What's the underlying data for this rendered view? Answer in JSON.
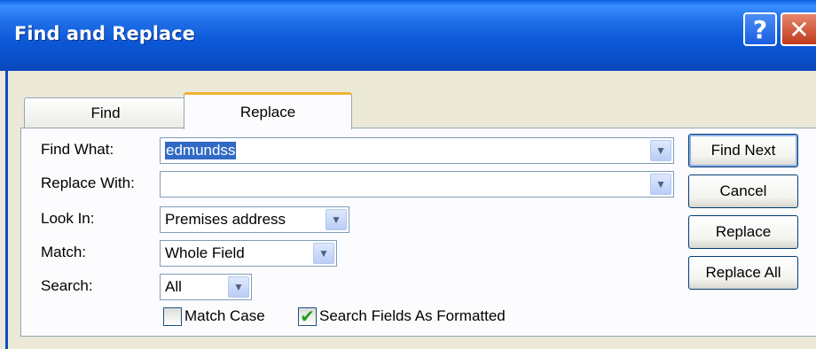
{
  "window": {
    "title": "Find and Replace",
    "help_glyph": "?",
    "close_glyph": "✕"
  },
  "tabs": [
    {
      "label": "Find",
      "active": false
    },
    {
      "label": "Replace",
      "active": true
    }
  ],
  "fields": {
    "find_what": {
      "label": "Find What:",
      "value": "edmundss"
    },
    "replace_with": {
      "label": "Replace With:",
      "value": ""
    },
    "look_in": {
      "label": "Look In:",
      "value": "Premises address"
    },
    "match": {
      "label": "Match:",
      "value": "Whole Field"
    },
    "search": {
      "label": "Search:",
      "value": "All"
    }
  },
  "checkboxes": {
    "match_case": {
      "label": "Match Case",
      "checked": false
    },
    "search_formatted": {
      "label": "Search Fields As Formatted",
      "checked": true
    }
  },
  "buttons": {
    "find_next": "Find Next",
    "cancel": "Cancel",
    "replace": "Replace",
    "replace_all": "Replace All"
  },
  "icons": {
    "dropdown": "chevron-down-icon",
    "checkmark": "checkmark-icon"
  },
  "colors": {
    "titlebar": "#0b57d6",
    "tab_accent": "#f2b233",
    "selection": "#316ac5",
    "check_green": "#21a121"
  }
}
